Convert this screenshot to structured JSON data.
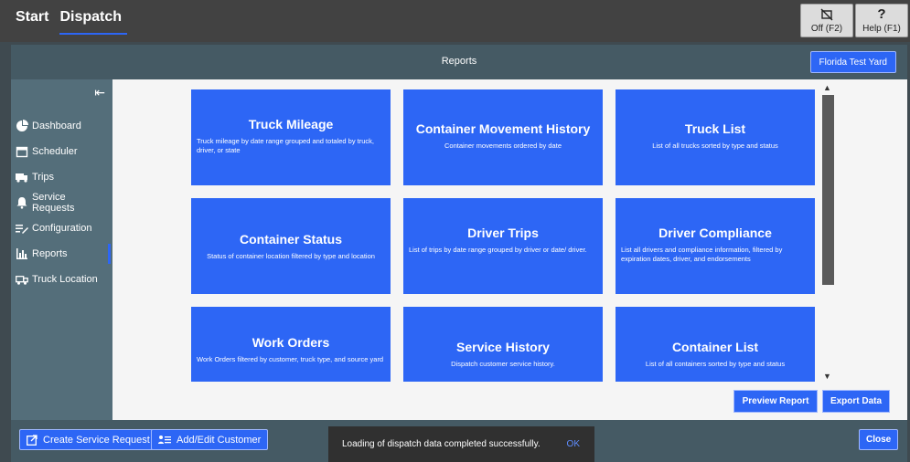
{
  "topbar": {
    "nav": [
      "Start",
      "Dispatch"
    ],
    "off_label": "Off (F2)",
    "help_label": "Help (F1)",
    "help_icon": "?"
  },
  "header": {
    "title": "Reports",
    "yard": "Florida Test Yard"
  },
  "sidebar": {
    "items": [
      {
        "label": "Dashboard",
        "icon": "pie-chart-icon"
      },
      {
        "label": "Scheduler",
        "icon": "calendar-icon"
      },
      {
        "label": "Trips",
        "icon": "truck-icon"
      },
      {
        "label": "Service Requests",
        "icon": "bell-icon"
      },
      {
        "label": "Configuration",
        "icon": "list-edit-icon"
      },
      {
        "label": "Reports",
        "icon": "bar-chart-icon"
      },
      {
        "label": "Truck Location",
        "icon": "truck-location-icon"
      }
    ]
  },
  "tiles": [
    {
      "title": "Truck Mileage",
      "desc": "Truck mileage by date range grouped and totaled by truck, driver, or state"
    },
    {
      "title": "Container Movement History",
      "desc": "Container movements ordered by date"
    },
    {
      "title": "Truck List",
      "desc": "List of all trucks sorted by type and status"
    },
    {
      "title": "Container Status",
      "desc": "Status of container location filtered by type and location"
    },
    {
      "title": "Driver Trips",
      "desc": "List of trips by date range grouped by driver or date/ driver."
    },
    {
      "title": "Driver Compliance",
      "desc": "List all drivers and compliance information, filtered by expiration dates, driver, and endorsements"
    },
    {
      "title": "Work Orders",
      "desc": "Work Orders filtered by customer, truck type, and source yard"
    },
    {
      "title": "Service History",
      "desc": "Dispatch customer service history."
    },
    {
      "title": "Container List",
      "desc": "List of all containers sorted by type and status"
    }
  ],
  "actions": {
    "preview": "Preview Report",
    "export": "Export Data"
  },
  "bottom": {
    "create": "Create Service Request",
    "customer": "Add/Edit Customer",
    "close": "Close"
  },
  "toast": {
    "message": "Loading of dispatch data completed successfully.",
    "ok": "OK"
  },
  "colors": {
    "accent": "#2d66f5",
    "topbar": "#424242",
    "sidebar": "#546e7a",
    "header": "#455a64"
  }
}
